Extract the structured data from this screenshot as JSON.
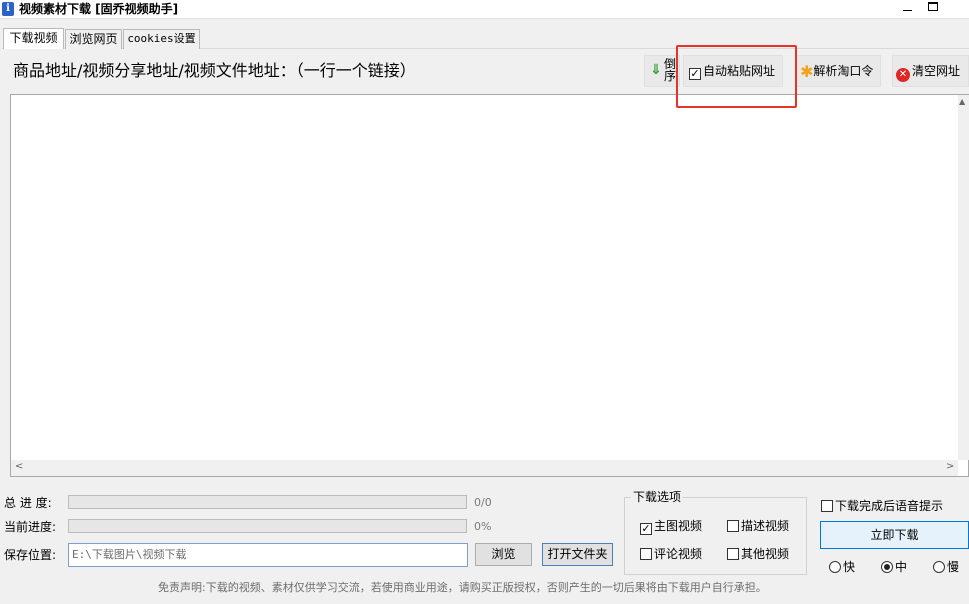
{
  "window": {
    "title": "视频素材下载 [固乔视频助手]",
    "icon": "i"
  },
  "tabs": [
    {
      "label": "下载视频",
      "active": true
    },
    {
      "label": "浏览网页",
      "active": false
    },
    {
      "label": "cookies设置",
      "active": false
    }
  ],
  "input_area": {
    "label": "商品地址/视频分享地址/视频文件地址：（一行一个链接）",
    "value": ""
  },
  "toolbar": {
    "reverse_label": "倒序",
    "auto_paste_label": "自动粘贴网址",
    "auto_paste_checked": true,
    "parse_label": "解析淘口令",
    "clear_label": "清空网址"
  },
  "progress": {
    "total_label": "总 进 度:",
    "total_value": "0/0",
    "current_label": "当前进度:",
    "current_value": "0%"
  },
  "save": {
    "label": "保存位置:",
    "path": "E:\\下载图片\\视频下载",
    "browse_label": "浏览",
    "open_folder_label": "打开文件夹"
  },
  "download_options": {
    "legend": "下载选项",
    "items": [
      {
        "label": "主图视频",
        "checked": true
      },
      {
        "label": "描述视频",
        "checked": false
      },
      {
        "label": "评论视频",
        "checked": false
      },
      {
        "label": "其他视频",
        "checked": false
      }
    ]
  },
  "voice_hint": {
    "label": "下载完成后语音提示",
    "checked": false
  },
  "start_button_label": "立即下载",
  "speed": {
    "options": [
      {
        "label": "快",
        "selected": false
      },
      {
        "label": "中",
        "selected": true
      },
      {
        "label": "慢",
        "selected": false
      }
    ]
  },
  "disclaimer": "免责声明:下载的视频、素材仅供学习交流，若使用商业用途，请购买正版授权，否则产生的一切后果将由下载用户自行承担。",
  "icons": {
    "reverse": "down-arrow-icon",
    "parse": "asterisk-icon",
    "clear": "red-x-icon"
  }
}
